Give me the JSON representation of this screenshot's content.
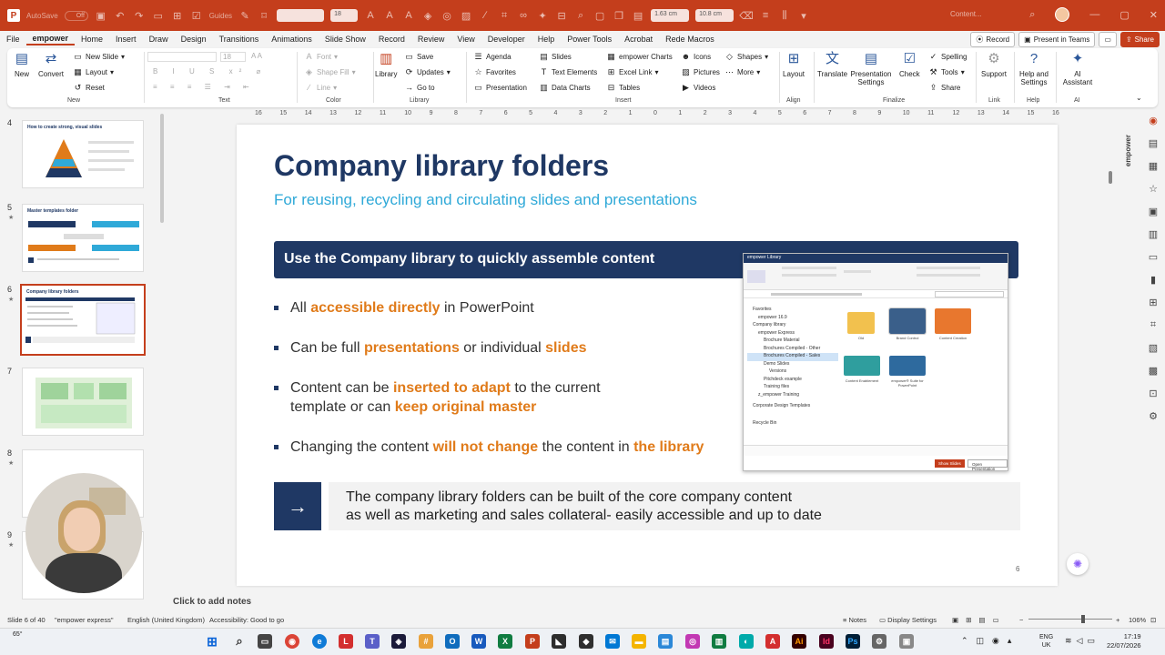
{
  "titlebar": {
    "autosave_label": "AutoSave",
    "autosave_state": "Off",
    "guides_label": "Guides",
    "font_size_value": "18",
    "width_value": "1.63 cm",
    "height_value": "10.8 cm",
    "doc_title": "Content..."
  },
  "tabs": [
    "File",
    "empower",
    "Home",
    "Insert",
    "Draw",
    "Design",
    "Transitions",
    "Animations",
    "Slide Show",
    "Record",
    "Review",
    "View",
    "Developer",
    "Help",
    "Power Tools",
    "Acrobat",
    "Rede Macros"
  ],
  "tab_actions": {
    "record": "Record",
    "present": "Present in Teams",
    "share": "Share"
  },
  "ribbon": {
    "new_group": {
      "new": "New",
      "convert": "Convert",
      "new_slide": "New Slide",
      "layout": "Layout",
      "reset": "Reset",
      "label": "New"
    },
    "text_group": {
      "font_size": "18",
      "label": "Text"
    },
    "color_group": {
      "font": "Font",
      "shape_fill": "Shape Fill",
      "line": "Line",
      "label": "Color"
    },
    "library_group": {
      "library": "Library",
      "save": "Save",
      "updates": "Updates",
      "go_to": "Go to",
      "label": "Library"
    },
    "insert_group": {
      "agenda": "Agenda",
      "favorites": "Favorites",
      "presentation": "Presentation",
      "slides": "Slides",
      "text_elements": "Text Elements",
      "data_charts": "Data Charts",
      "empower_charts": "empower Charts",
      "excel_link": "Excel Link",
      "tables": "Tables",
      "icons": "Icons",
      "pictures": "Pictures",
      "videos": "Videos",
      "shapes": "Shapes",
      "more": "More",
      "label": "Insert"
    },
    "align_group": {
      "layout": "Layout",
      "label": "Align"
    },
    "finalize_group": {
      "translate": "Translate",
      "presentation_settings": "Presentation Settings",
      "check": "Check",
      "spelling": "Spelling",
      "tools": "Tools",
      "share": "Share",
      "label": "Finalize"
    },
    "link_group": {
      "support": "Support",
      "label": "Link"
    },
    "help_group": {
      "help_settings": "Help and Settings",
      "label": "Help"
    },
    "ai_group": {
      "ai_assistant": "AI Assistant",
      "label": "AI"
    }
  },
  "thumbnails": [
    {
      "number": "4",
      "title": "How to create strong, visual slides"
    },
    {
      "number": "5",
      "title": "Master templates folder"
    },
    {
      "number": "6",
      "title": "Company library folders"
    },
    {
      "number": "7",
      "title": ""
    },
    {
      "number": "8",
      "title": ""
    },
    {
      "number": "9",
      "title": ""
    }
  ],
  "ruler_ticks": [
    "16",
    "15",
    "14",
    "13",
    "12",
    "11",
    "10",
    "9",
    "8",
    "7",
    "6",
    "5",
    "4",
    "3",
    "2",
    "1",
    "0",
    "1",
    "2",
    "3",
    "4",
    "5",
    "6",
    "7",
    "8",
    "9",
    "10",
    "11",
    "12",
    "13",
    "14",
    "15",
    "16"
  ],
  "slide": {
    "title": "Company library folders",
    "subtitle": "For reusing, recycling and circulating slides and presentations",
    "banner": "Use the Company library to quickly assemble content",
    "bullets": [
      {
        "pre": "All ",
        "hl1": "accessible directly",
        "mid": " in PowerPoint",
        "hl2": "",
        "post": ""
      },
      {
        "pre": "Can be full ",
        "hl1": "presentations",
        "mid": " or individual ",
        "hl2": "slides",
        "post": ""
      },
      {
        "pre": "Content can be ",
        "hl1": "inserted to adapt",
        "mid": " to the current template or can ",
        "hl2": "keep original master",
        "post": ""
      },
      {
        "pre": "Changing the content ",
        "hl1": "will not change",
        "mid": " the content in ",
        "hl2": "the library",
        "post": ""
      }
    ],
    "callout_line1": "The company library folders can be built of the core company content",
    "callout_line2": "as well as marketing and sales collateral- easily accessible and up to date",
    "page_number": "6",
    "embedded": {
      "window_title": "empower Library",
      "tree": [
        "Favorites",
        "empower 16.9",
        "Company library",
        "empower Express",
        "Brochure Material",
        "Brochures Compiled - Other",
        "Brochures Compiled - Sales",
        "Demo Slides",
        "Versions",
        "Pitchdeck example",
        "Training files",
        "z_empower Training",
        "Corporate Design Templates",
        "Recycle Bin"
      ],
      "items": [
        "Old",
        "Brand Control",
        "Content Creation",
        "Content Enablement",
        "empower® Suite for PowerPoint"
      ],
      "show_slides": "Show Slides",
      "open_presentation": "Open Presentation"
    }
  },
  "notes_placeholder": "Click to add notes",
  "status": {
    "slide_count": "Slide 6 of 40",
    "theme": "\"empower express\"",
    "language": "English (United Kingdom)",
    "accessibility": "Accessibility: Good to go",
    "notes": "Notes",
    "display_settings": "Display Settings",
    "zoom": "106%"
  },
  "taskbar": {
    "temp": "65°",
    "lang1": "ENG",
    "lang2": "UK",
    "time": "17:19",
    "date": "22/07/2026"
  },
  "colors": {
    "accent": "#c43e1c",
    "navy": "#1f3864",
    "orange": "#e07b1a",
    "cyan": "#2fa9d8"
  }
}
